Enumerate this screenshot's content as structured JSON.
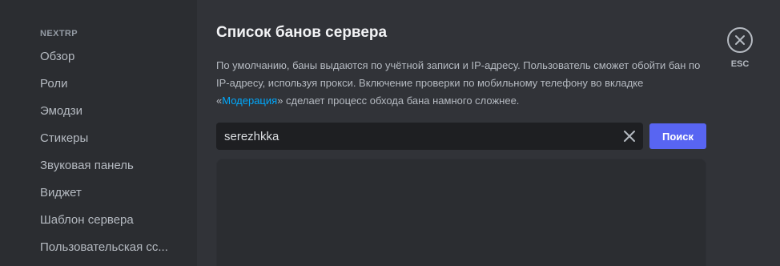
{
  "sidebar": {
    "header": "NEXTRP",
    "items": [
      {
        "label": "Обзор"
      },
      {
        "label": "Роли"
      },
      {
        "label": "Эмодзи"
      },
      {
        "label": "Стикеры"
      },
      {
        "label": "Звуковая панель"
      },
      {
        "label": "Виджет"
      },
      {
        "label": "Шаблон сервера"
      },
      {
        "label": "Пользовательская сс..."
      }
    ]
  },
  "main": {
    "title": "Список банов сервера",
    "description_part1": "По умолчанию, баны выдаются по учётной записи и IP-адресу. Пользователь сможет обойти бан по IP-адресу, используя прокси. Включение проверки по мобильному телефону во вкладке «",
    "description_link": "Модерация",
    "description_part2": "» сделает процесс обхода бана намного сложнее.",
    "search": {
      "value": "serezhkka",
      "button_label": "Поиск"
    }
  },
  "close": {
    "label": "ESC"
  },
  "icons": {
    "clear": "close-icon",
    "close": "close-circle-icon"
  },
  "colors": {
    "accent": "#5865f2",
    "link": "#00a8fc",
    "sidebar_bg": "#2b2d31",
    "main_bg": "#313338",
    "input_bg": "#1e1f22"
  }
}
